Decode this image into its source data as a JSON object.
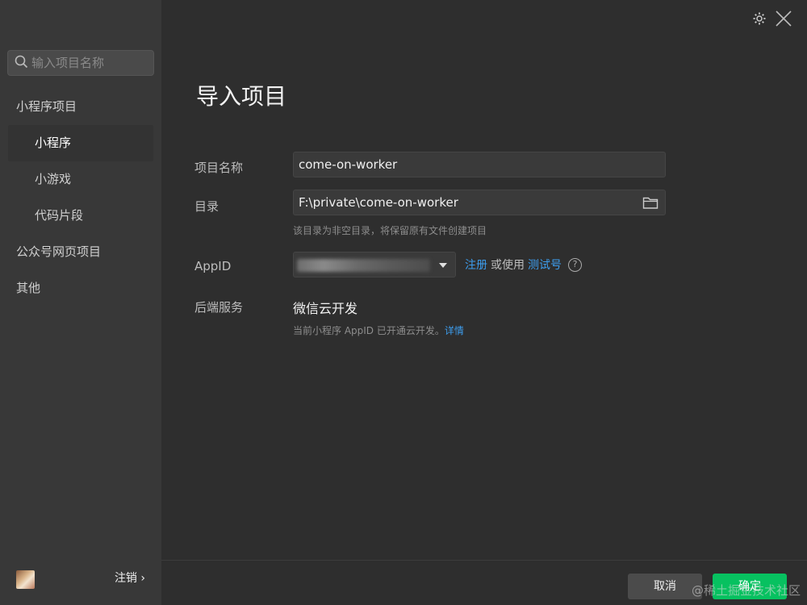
{
  "sidebar": {
    "search_placeholder": "输入项目名称",
    "items": [
      {
        "label": "小程序项目"
      },
      {
        "label": "小程序"
      },
      {
        "label": "小游戏"
      },
      {
        "label": "代码片段"
      },
      {
        "label": "公众号网页项目"
      },
      {
        "label": "其他"
      }
    ],
    "logout_label": "注销 ›"
  },
  "main": {
    "title": "导入项目",
    "project_name_label": "项目名称",
    "project_name_value": "come-on-worker",
    "directory_label": "目录",
    "directory_value": "F:\\private\\come-on-worker",
    "directory_hint": "该目录为非空目录，将保留原有文件创建项目",
    "appid_label": "AppID",
    "register_link": "注册",
    "or_use_text": "或使用",
    "test_account_link": "测试号",
    "help_glyph": "?",
    "backend_label": "后端服务",
    "backend_value": "微信云开发",
    "backend_hint": "当前小程序 AppID 已开通云开发。",
    "backend_details_link": "详情"
  },
  "footer": {
    "cancel_label": "取消",
    "confirm_label": "确定"
  },
  "watermark": "@稀土掘金技术社区",
  "colors": {
    "accent_green": "#07c160",
    "link_blue": "#3d9ded",
    "sidebar_bg": "#383838",
    "main_bg": "#2e2e2e"
  },
  "icons": [
    "search-icon",
    "gear-icon",
    "close-icon",
    "folder-icon",
    "chevron-down-icon",
    "help-icon"
  ]
}
